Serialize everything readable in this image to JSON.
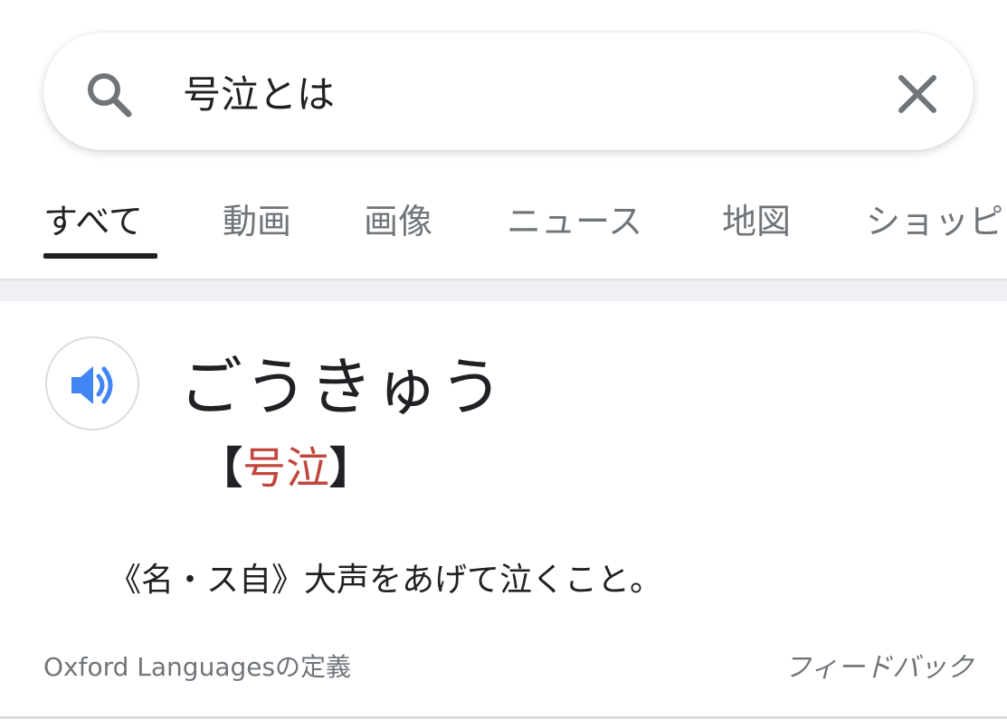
{
  "search": {
    "query": "号泣とは"
  },
  "tabs": [
    {
      "label": "すべて",
      "active": true
    },
    {
      "label": "動画",
      "active": false
    },
    {
      "label": "画像",
      "active": false
    },
    {
      "label": "ニュース",
      "active": false
    },
    {
      "label": "地図",
      "active": false
    },
    {
      "label": "ショッピ",
      "active": false
    }
  ],
  "dictionary": {
    "reading": "ごうきゅう",
    "bracket_open": "【",
    "kanji": "号泣",
    "bracket_close": "】",
    "definition": "《名・ス自》大声をあげて泣くこと。",
    "source": "Oxford Languagesの定義",
    "feedback_label": "フィードバック"
  },
  "icons": {
    "search": "search-icon",
    "clear": "close-icon",
    "speaker": "speaker-icon"
  },
  "colors": {
    "speaker_blue": "#4285f4",
    "kanji_red": "#c0473d",
    "text_dark": "#202124",
    "text_gray": "#70757a"
  }
}
